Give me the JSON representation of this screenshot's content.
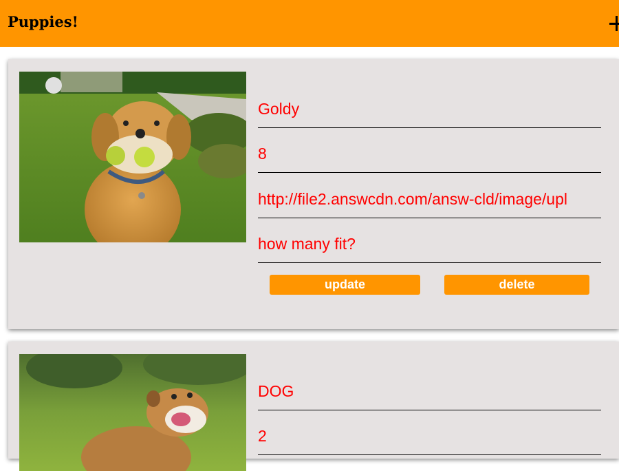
{
  "header": {
    "title": "Puppies!",
    "add_icon": "plus-icon"
  },
  "colors": {
    "accent": "#ff9500",
    "card_bg": "#e6e2e2",
    "field_text": "#ff0000",
    "button_text": "#ffffff"
  },
  "puppies": [
    {
      "name": "Goldy",
      "age": "8",
      "image_url": "http://file2.answcdn.com/answ-cld/image/upl",
      "question": "how many fit?",
      "update_label": "update",
      "delete_label": "delete",
      "image": "golden-retriever-photo"
    },
    {
      "name": "DOG",
      "age": "2",
      "image": "bulldog-photo"
    }
  ]
}
